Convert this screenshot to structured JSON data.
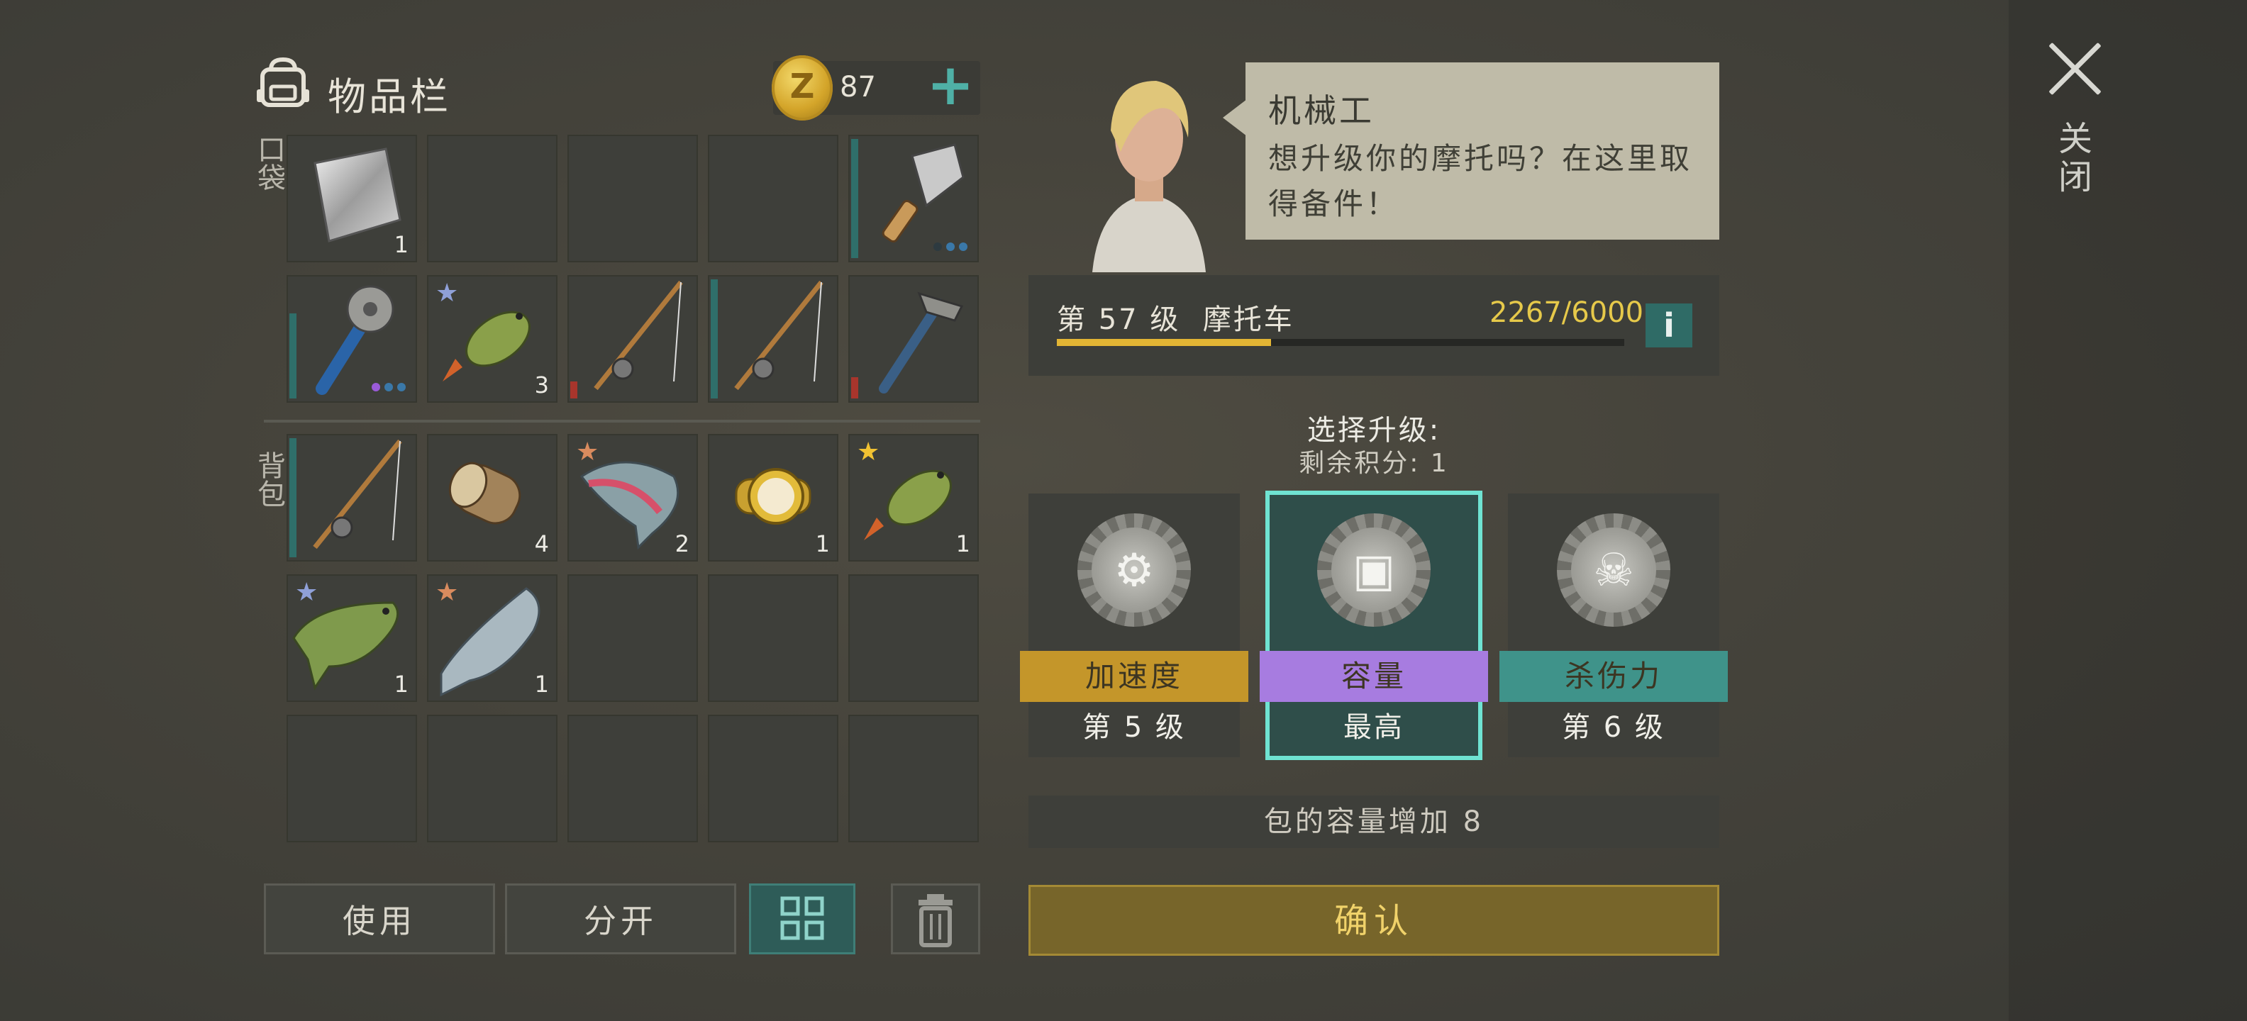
{
  "close": {
    "label": "关闭"
  },
  "inventory": {
    "title": "物品栏",
    "coins": "87",
    "coin_symbol": "Z",
    "pocket_label": "口袋",
    "backpack_label": "背包",
    "pocket_slots": [
      {
        "item": "metal-sheet",
        "count": "1"
      },
      {
        "item": "empty",
        "count": ""
      },
      {
        "item": "empty",
        "count": ""
      },
      {
        "item": "empty",
        "count": ""
      },
      {
        "item": "cleaver",
        "count": ""
      },
      {
        "item": "spiked-club",
        "count": ""
      },
      {
        "item": "perch-fish",
        "count": "3"
      },
      {
        "item": "fishing-rod",
        "count": ""
      },
      {
        "item": "fishing-rod",
        "count": ""
      },
      {
        "item": "hatchet",
        "count": ""
      }
    ],
    "backpack_slots": [
      {
        "item": "fishing-rod",
        "count": ""
      },
      {
        "item": "wood-log",
        "count": "4"
      },
      {
        "item": "rainbow-trout",
        "count": "2"
      },
      {
        "item": "gold-watch",
        "count": "1"
      },
      {
        "item": "perch-fish",
        "count": "1"
      },
      {
        "item": "pike-fish",
        "count": "1"
      },
      {
        "item": "salmon",
        "count": "1"
      }
    ],
    "buttons": {
      "use": "使用",
      "split": "分开"
    }
  },
  "npc": {
    "name": "机械工",
    "message": "想升级你的摩托吗？在这里取得备件！"
  },
  "vehicle": {
    "level_text": "第 57 级",
    "name": "摩托车",
    "xp": "2267/6000",
    "xp_progress": 0.378,
    "info_label": "i"
  },
  "upgrade": {
    "title": "选择升级:",
    "remaining": "剩余积分: 1",
    "options": [
      {
        "label": "加速度",
        "level": "第 5 级",
        "color": "#c4962a",
        "glyph": "⚙"
      },
      {
        "label": "容量",
        "level": "最高",
        "color": "#a77ce0",
        "glyph": "▣"
      },
      {
        "label": "杀伤力",
        "level": "第 6 级",
        "color": "#3f938a",
        "glyph": "☠"
      }
    ],
    "description": "包的容量增加 8",
    "confirm": "确认"
  }
}
